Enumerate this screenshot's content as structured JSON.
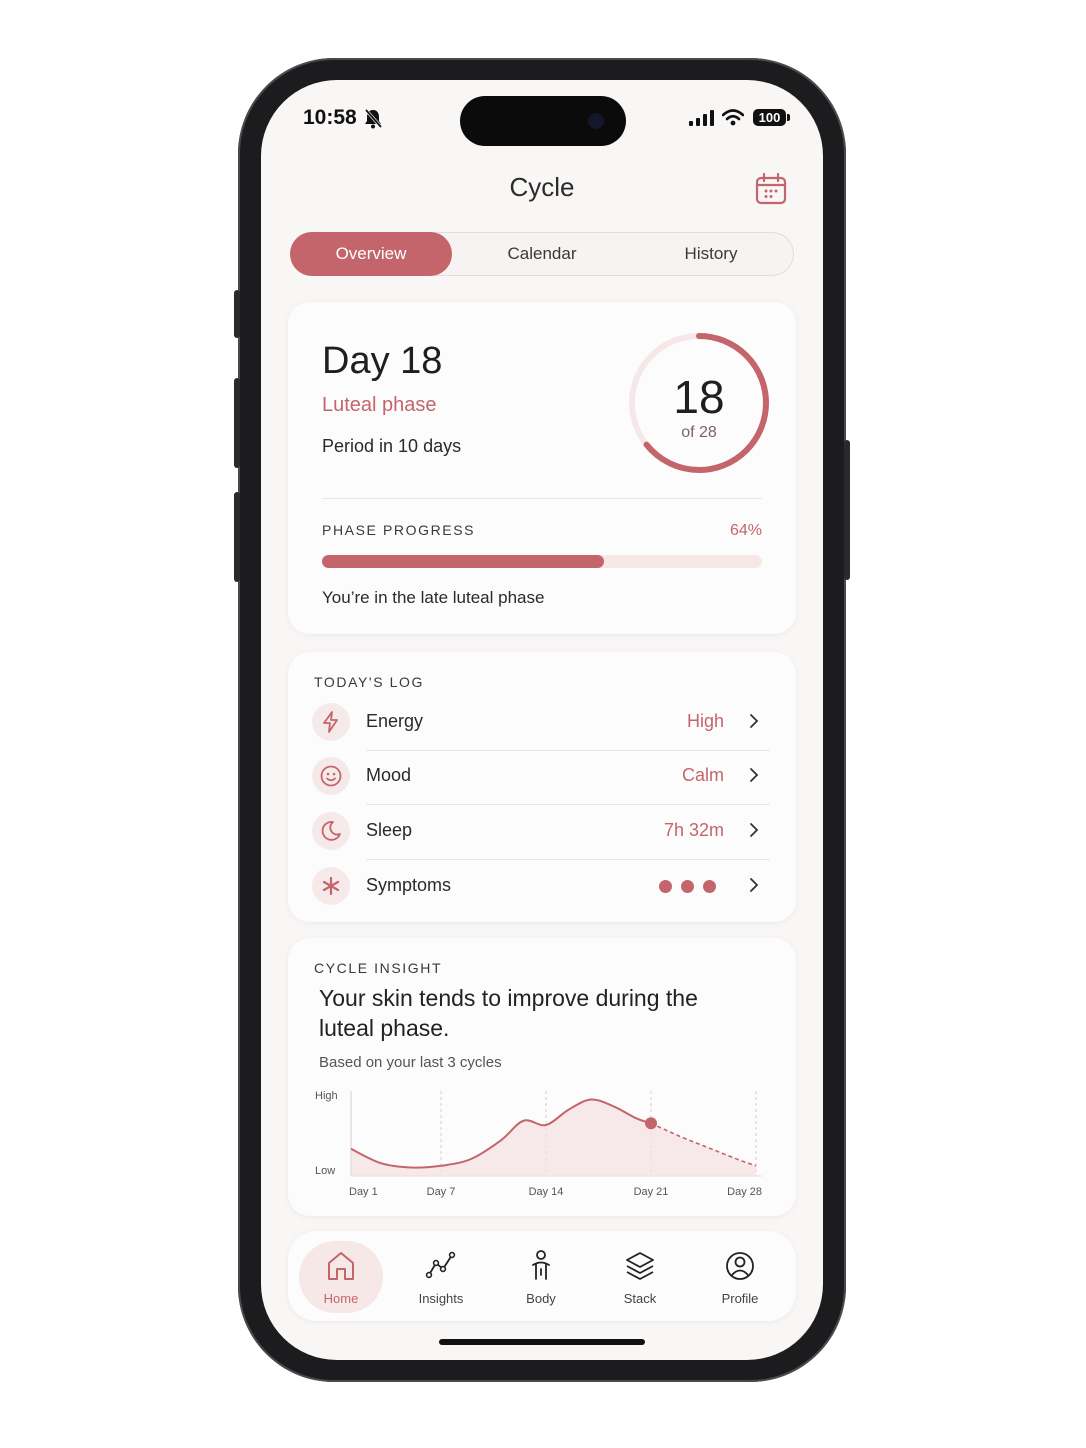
{
  "status_bar": {
    "time": "10:58",
    "battery": "100"
  },
  "header": {
    "title": "Cycle"
  },
  "tabs": [
    {
      "label": "Overview",
      "active": true
    },
    {
      "label": "Calendar",
      "active": false
    },
    {
      "label": "History",
      "active": false
    }
  ],
  "cycle": {
    "day_title": "Day 18",
    "phase": "Luteal phase",
    "period_note": "Period in 10 days",
    "day_number": "18",
    "of_total": "of 28",
    "progress_fraction": 0.6429
  },
  "phase_progress": {
    "label": "PHASE PROGRESS",
    "percent_text": "64%",
    "percent": 64,
    "note": "You’re in the late luteal phase"
  },
  "todays_log": {
    "heading": "TODAY'S LOG",
    "items": [
      {
        "label": "Energy",
        "value": "High",
        "icon": "lightning-icon"
      },
      {
        "label": "Mood",
        "value": "Calm",
        "icon": "smiley-icon"
      },
      {
        "label": "Sleep",
        "value": "7h 32m",
        "icon": "moon-icon"
      },
      {
        "label": "Symptoms",
        "value": "",
        "icon": "asterisk-icon",
        "dots": 3
      }
    ]
  },
  "insight": {
    "heading": "CYCLE INSIGHT",
    "text": "Your skin tends to improve during the luteal phase.",
    "sub": "Based on your last 3 cycles"
  },
  "chart_data": {
    "type": "area",
    "y_tick_labels": [
      "High",
      "Low"
    ],
    "x_tick_labels": [
      "Day 1",
      "Day 7",
      "Day 14",
      "Day 21",
      "Day 28"
    ],
    "x_ticks": [
      1,
      7,
      14,
      21,
      28
    ],
    "xlim": [
      1,
      28
    ],
    "ylim": [
      0,
      1
    ],
    "series": [
      {
        "x": [
          1,
          3,
          5,
          7,
          9,
          11,
          12.5,
          14,
          15.5,
          17,
          18.5,
          20,
          21
        ],
        "y": [
          0.32,
          0.15,
          0.1,
          0.12,
          0.2,
          0.42,
          0.65,
          0.6,
          0.78,
          0.9,
          0.82,
          0.68,
          0.62
        ],
        "style": "solid"
      },
      {
        "x": [
          21,
          23,
          25,
          27,
          28
        ],
        "y": [
          0.62,
          0.46,
          0.32,
          0.18,
          0.12
        ],
        "style": "dashed"
      }
    ],
    "highlight": {
      "x": 21,
      "y": 0.62
    },
    "colors": {
      "line": "#c4656c",
      "fill": "#f4e2e3"
    }
  },
  "bottom_nav": [
    {
      "label": "Home",
      "icon": "home-icon",
      "active": true
    },
    {
      "label": "Insights",
      "icon": "insights-icon",
      "active": false
    },
    {
      "label": "Body",
      "icon": "body-icon",
      "active": false
    },
    {
      "label": "Stack",
      "icon": "stack-icon",
      "active": false
    },
    {
      "label": "Profile",
      "icon": "profile-icon",
      "active": false
    }
  ],
  "colors": {
    "accent": "#c4656c",
    "accent_light": "#f7e8e8",
    "background": "#f9f7f6"
  }
}
